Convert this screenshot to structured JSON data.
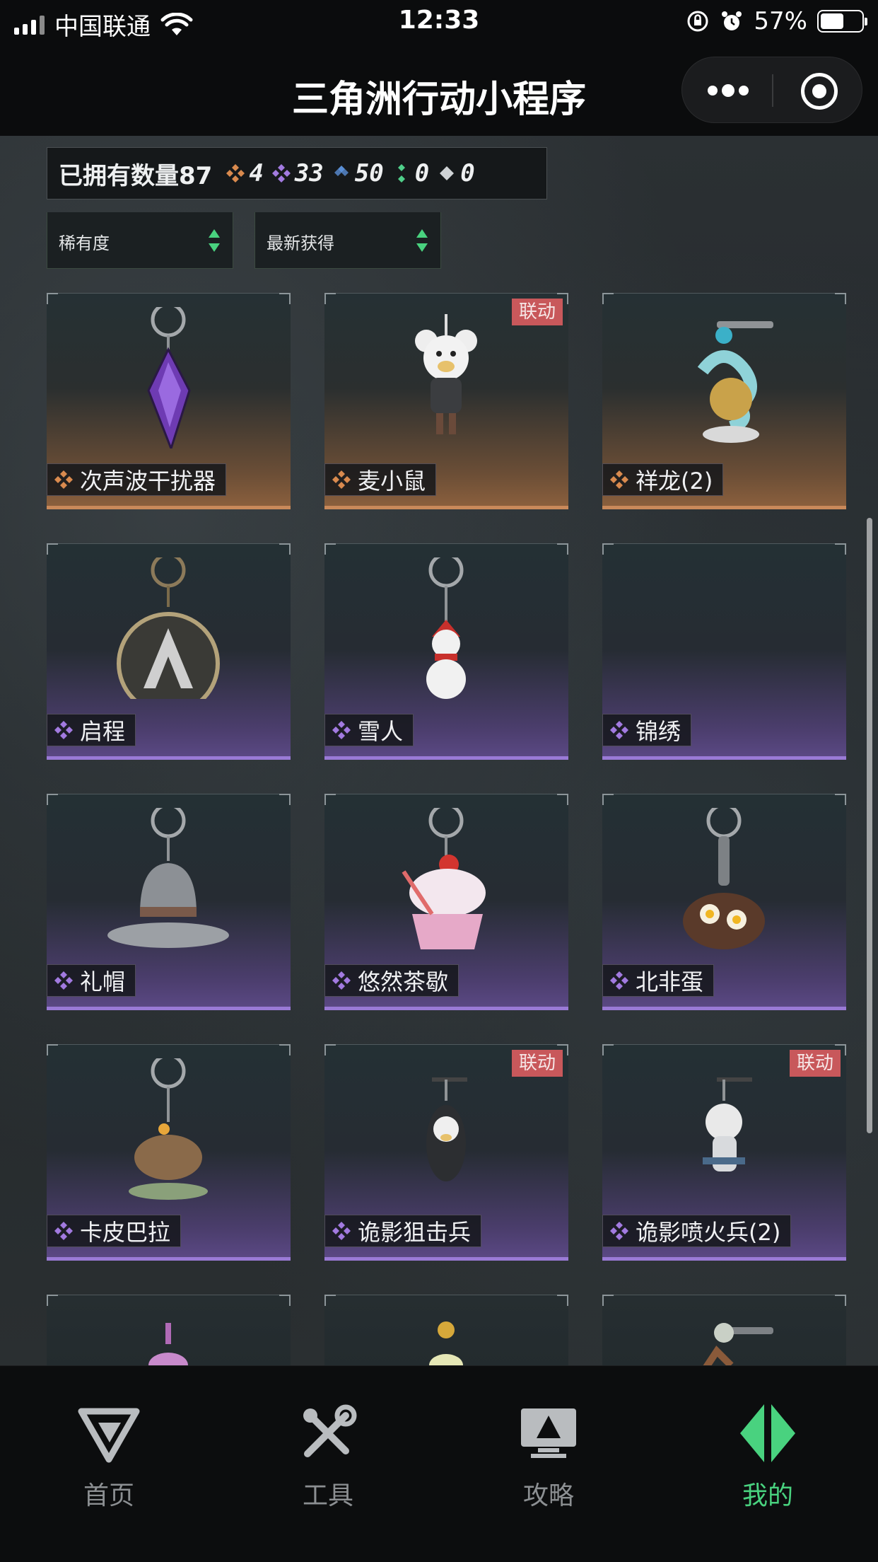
{
  "status_bar": {
    "carrier": "中国联通",
    "time": "12:33",
    "battery_percent": "57%",
    "battery_level": 0.57
  },
  "nav": {
    "title": "三角洲行动小程序"
  },
  "summary": {
    "owned_label": "已拥有数量87",
    "stats": [
      {
        "icon": "gold-diamond-icon",
        "color": "#d98a4e",
        "value": "4"
      },
      {
        "icon": "purple-diamond-icon",
        "color": "#a27ae0",
        "value": "33"
      },
      {
        "icon": "blue-diamond-icon",
        "color": "#5a8fd6",
        "value": "50"
      },
      {
        "icon": "green-diamond-icon",
        "color": "#4fcf8a",
        "value": "0"
      },
      {
        "icon": "white-diamond-icon",
        "color": "#cfd3d6",
        "value": "0"
      }
    ]
  },
  "filters": [
    {
      "label": "稀有度"
    },
    {
      "label": "最新获得"
    }
  ],
  "items": [
    {
      "name": "次声波干扰器",
      "rarity": "gold",
      "collab": ""
    },
    {
      "name": "麦小鼠",
      "rarity": "gold",
      "collab": "联动"
    },
    {
      "name": "祥龙(2)",
      "rarity": "gold",
      "collab": ""
    },
    {
      "name": "启程",
      "rarity": "purple",
      "collab": ""
    },
    {
      "name": "雪人",
      "rarity": "purple",
      "collab": ""
    },
    {
      "name": "锦绣",
      "rarity": "purple",
      "collab": ""
    },
    {
      "name": "礼帽",
      "rarity": "purple",
      "collab": ""
    },
    {
      "name": "悠然茶歇",
      "rarity": "purple",
      "collab": ""
    },
    {
      "name": "北非蛋",
      "rarity": "purple",
      "collab": ""
    },
    {
      "name": "卡皮巴拉",
      "rarity": "purple",
      "collab": ""
    },
    {
      "name": "诡影狙击兵",
      "rarity": "purple",
      "collab": "联动"
    },
    {
      "name": "诡影喷火兵(2)",
      "rarity": "purple",
      "collab": "联动"
    }
  ],
  "tabs": [
    {
      "label": "首页",
      "icon": "home-icon",
      "active": false
    },
    {
      "label": "工具",
      "icon": "tools-icon",
      "active": false
    },
    {
      "label": "攻略",
      "icon": "guide-icon",
      "active": false
    },
    {
      "label": "我的",
      "icon": "profile-icon",
      "active": true
    }
  ],
  "colors": {
    "accent_green": "#49d27f",
    "gold": "#c9895a",
    "purple": "#9a7ad6",
    "collab_badge": "#c8585b"
  }
}
